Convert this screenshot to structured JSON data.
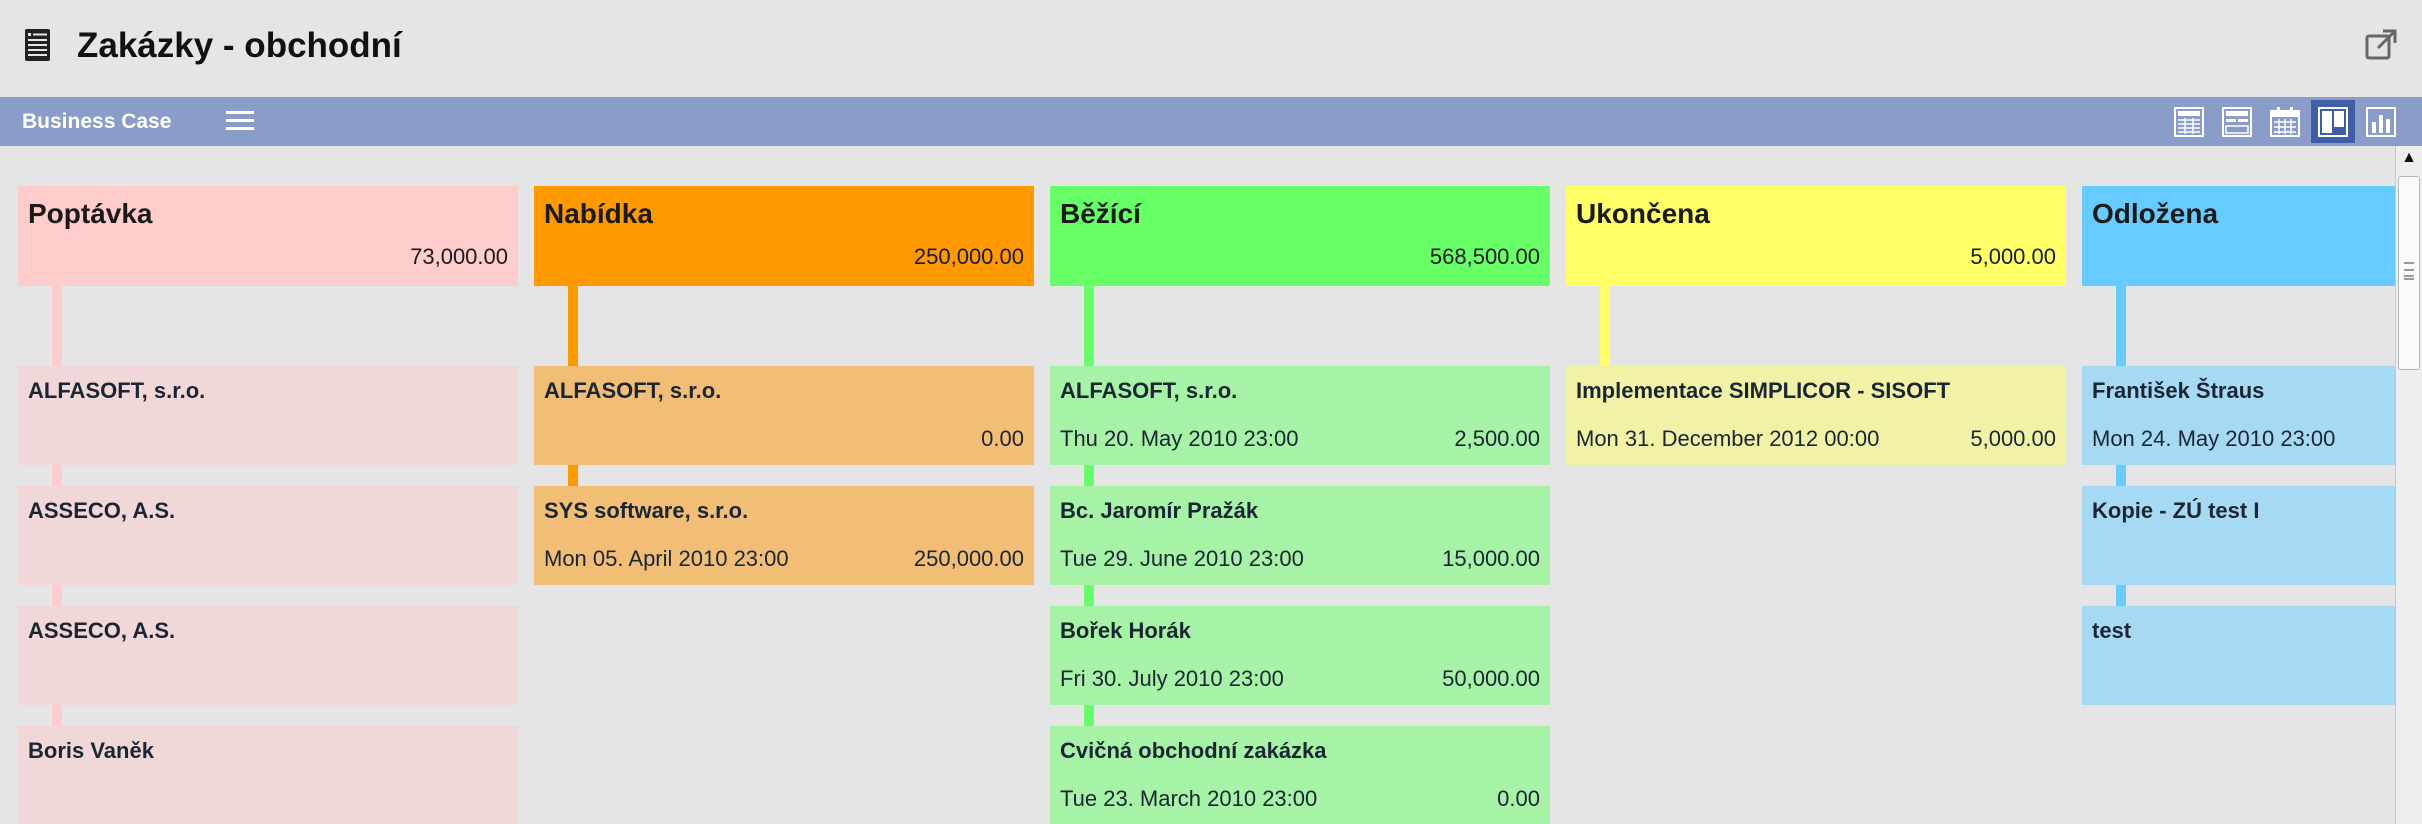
{
  "header": {
    "title": "Zakázky - obchodní",
    "doc_icon": "document-icon",
    "popout_icon": "external-link-icon"
  },
  "toolbar": {
    "title": "Business Case",
    "menu_icon": "hamburger-icon",
    "views": [
      {
        "icon": "table-view-icon",
        "active": false
      },
      {
        "icon": "form-view-icon",
        "active": false
      },
      {
        "icon": "calendar-view-icon",
        "active": false
      },
      {
        "icon": "kanban-view-icon",
        "active": true
      },
      {
        "icon": "chart-view-icon",
        "active": false
      }
    ]
  },
  "colors": {
    "poptavka": {
      "header": "#ffcccc",
      "card": "#f1d8d8",
      "stem": "#ffcccc"
    },
    "nabidka": {
      "header": "#ff9900",
      "card": "#f2be75",
      "stem": "#ff9900"
    },
    "bezici": {
      "header": "#66ff66",
      "card": "#a6f2a6",
      "stem": "#66ff66"
    },
    "ukoncena": {
      "header": "#ffff66",
      "card": "#f2f2a6",
      "stem": "#ffff66"
    },
    "odlozena": {
      "header": "#66ccff",
      "card": "#a6d9f2",
      "stem": "#66ccff"
    }
  },
  "columns": [
    {
      "name": "Poptávka",
      "total": "73,000.00",
      "cards": [
        {
          "name": "ALFASOFT, s.r.o.",
          "date": "",
          "amount": ""
        },
        {
          "name": "ASSECO, A.S.",
          "date": "",
          "amount": ""
        },
        {
          "name": "ASSECO, A.S.",
          "date": "",
          "amount": ""
        },
        {
          "name": "Boris Vaněk",
          "date": "",
          "amount": ""
        }
      ]
    },
    {
      "name": "Nabídka",
      "total": "250,000.00",
      "cards": [
        {
          "name": "ALFASOFT, s.r.o.",
          "date": "",
          "amount": "0.00"
        },
        {
          "name": "SYS software, s.r.o.",
          "date": "Mon 05. April 2010 23:00",
          "amount": "250,000.00"
        }
      ]
    },
    {
      "name": "Běžící",
      "total": "568,500.00",
      "cards": [
        {
          "name": "ALFASOFT, s.r.o.",
          "date": "Thu 20. May 2010 23:00",
          "amount": "2,500.00"
        },
        {
          "name": "Bc. Jaromír Pražák",
          "date": "Tue 29. June 2010 23:00",
          "amount": "15,000.00"
        },
        {
          "name": "Bořek Horák",
          "date": "Fri 30. July 2010 23:00",
          "amount": "50,000.00"
        },
        {
          "name": "Cvičná obchodní zakázka",
          "date": "Tue 23. March 2010 23:00",
          "amount": "0.00"
        }
      ]
    },
    {
      "name": "Ukončena",
      "total": "5,000.00",
      "cards": [
        {
          "name": "Implementace SIMPLICOR - SISOFT",
          "date": "Mon 31. December 2012 00:00",
          "amount": "5,000.00"
        }
      ]
    },
    {
      "name": "Odložena",
      "total": "",
      "cards": [
        {
          "name": "František Štraus",
          "date": "Mon 24. May 2010 23:00",
          "amount": ""
        },
        {
          "name": "Kopie - ZÚ test I",
          "date": "",
          "amount": ""
        },
        {
          "name": "test",
          "date": "",
          "amount": ""
        }
      ]
    }
  ]
}
